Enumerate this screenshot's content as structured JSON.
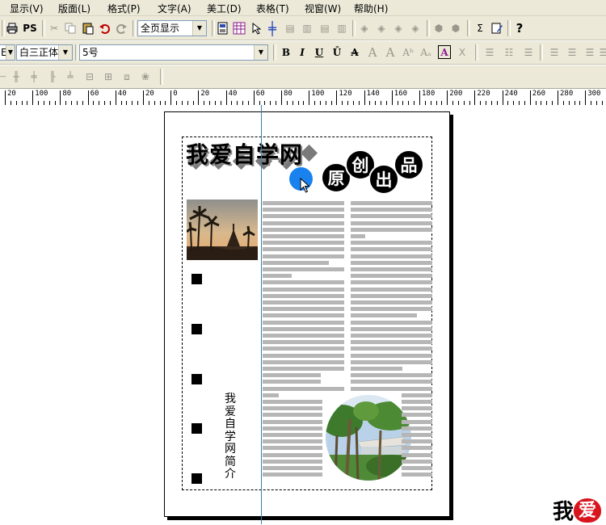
{
  "menubar": {
    "items": [
      "显示(V)",
      "版面(L)",
      "格式(P)",
      "文字(A)",
      "美工(D)",
      "表格(T)",
      "视窗(W)",
      "帮助(H)"
    ]
  },
  "toolbar1": {
    "ps_label": "PS",
    "view_select": "全页显示"
  },
  "toolbar2": {
    "font_partial": "E",
    "font_name": "白三正体",
    "font_size": "5号",
    "bold": "B",
    "italic": "I",
    "underline": "U",
    "overline": "Ū",
    "strike": "A",
    "hollow_a": "A",
    "outline_a": "A",
    "super_a": "Aᵇ",
    "sub_a": "Aₐ",
    "box_a": "A",
    "clear_x": "X"
  },
  "ruler": {
    "labels": [
      "20",
      "100",
      "80",
      "60",
      "40",
      "20",
      "0",
      "20",
      "40",
      "60",
      "80",
      "100",
      "120",
      "140",
      "160",
      "180",
      "200",
      "220",
      "240",
      "260",
      "280",
      "300"
    ]
  },
  "document": {
    "title": "我爱自学网",
    "circle_chars": [
      "原",
      "创",
      "出",
      "品"
    ],
    "vertical_text": "我爱自学网简介"
  },
  "watermark": {
    "char1": "我",
    "char2": "爱"
  },
  "colors": {
    "chrome": "#ece9d8",
    "text_line": "#b6b6b6",
    "guide_line": "#3c7fa6",
    "blue_dot": "#1a82ef"
  }
}
